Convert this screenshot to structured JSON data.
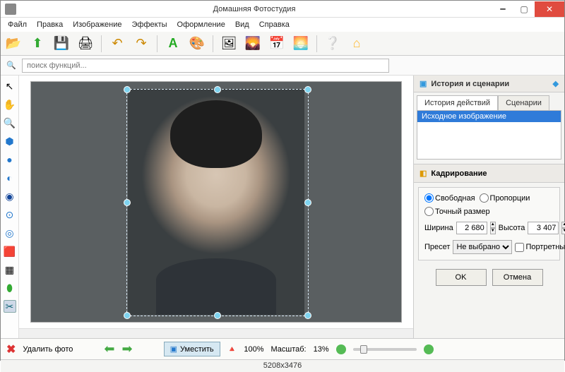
{
  "window": {
    "title": "Домашняя Фотостудия"
  },
  "menu": [
    "Файл",
    "Правка",
    "Изображение",
    "Эффекты",
    "Оформление",
    "Вид",
    "Справка"
  ],
  "search": {
    "placeholder": "поиск функций..."
  },
  "history_panel": {
    "title": "История и сценарии",
    "tab_history": "История действий",
    "tab_scenarios": "Сценарии",
    "item0": "Исходное изображение"
  },
  "crop_panel": {
    "title": "Кадрирование",
    "mode_free": "Свободная",
    "mode_prop": "Пропорции",
    "mode_exact": "Точный размер",
    "width_label": "Ширина",
    "width_value": "2 680",
    "height_label": "Высота",
    "height_value": "3 407",
    "preset_label": "Пресет",
    "preset_value": "Не выбрано",
    "portrait": "Портретные",
    "ok": "OK",
    "cancel": "Отмена"
  },
  "status": {
    "delete": "Удалить фото",
    "fit": "Уместить",
    "zoom100": "100%",
    "scale_label": "Масштаб:",
    "scale_value": "13%"
  },
  "footer": {
    "dims": "5208x3476"
  }
}
